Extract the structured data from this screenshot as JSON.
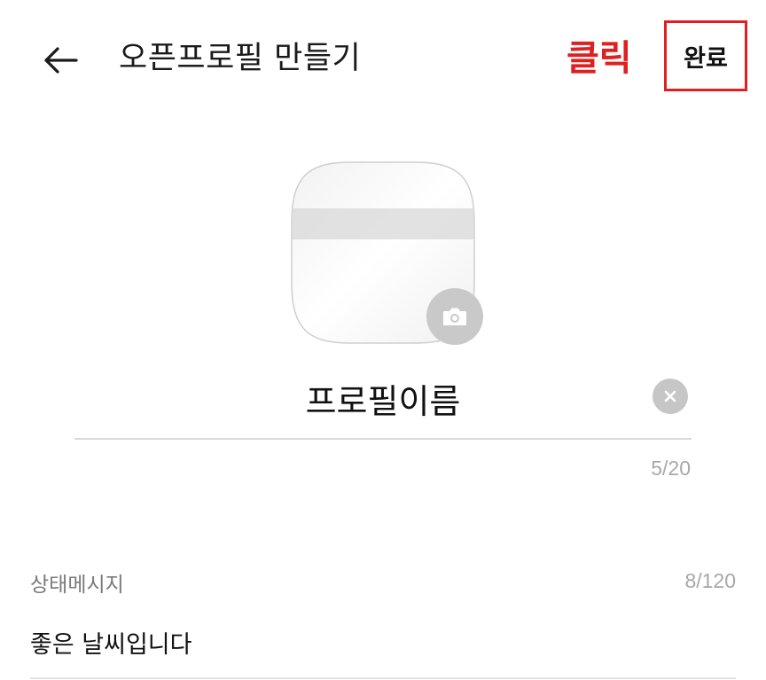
{
  "header": {
    "title": "오픈프로필 만들기",
    "annotation": "클릭",
    "done_label": "완료",
    "annotation_color": "#e02020",
    "back_icon": "arrow-left-icon"
  },
  "profile": {
    "image_icon": "profile-image",
    "camera_icon": "camera-icon",
    "name_value": "프로필이름",
    "name_counter": "5/20",
    "clear_icon": "clear-x-icon"
  },
  "status": {
    "label": "상태메시지",
    "counter": "8/120",
    "value": "좋은 날씨입니다"
  }
}
